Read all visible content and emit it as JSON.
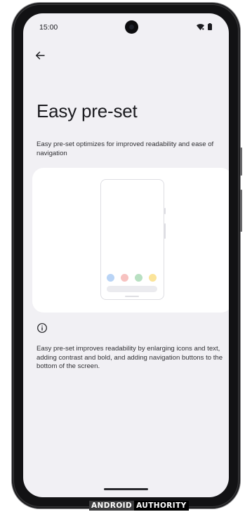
{
  "status_bar": {
    "time": "15:00",
    "icons": [
      "wifi-icon",
      "battery-icon"
    ]
  },
  "toolbar": {
    "back_icon": "arrow-back-icon"
  },
  "page": {
    "title": "Easy pre-set",
    "description": "Easy pre-set optimizes for improved readability and ease of navigation",
    "info_icon": "info-icon",
    "info_text": "Easy pre-set improves readability by enlarging icons and text, adding contrast and bold, and adding navigation buttons to the bottom of the screen."
  },
  "illustration": {
    "dot_colors": [
      "#b9d4f6",
      "#f7c2c0",
      "#b8e0c2",
      "#fbe49a"
    ]
  },
  "watermark": {
    "part1": "ANDROID",
    "part2": "AUTHORITY"
  }
}
